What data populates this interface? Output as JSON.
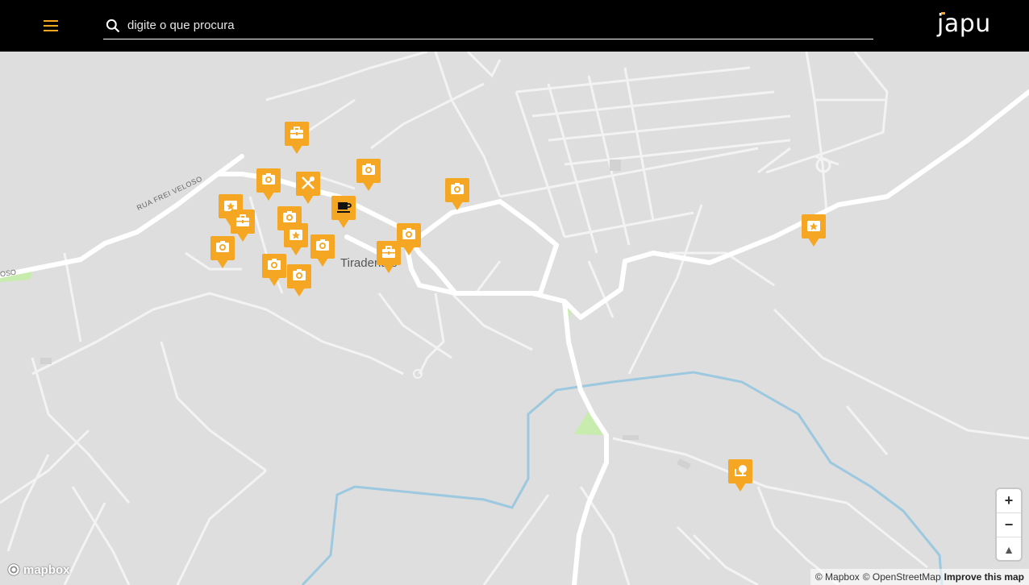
{
  "header": {
    "search_placeholder": "digite o que procura",
    "logo_text": "japu",
    "accent_color": "#f5a623"
  },
  "map": {
    "town_label": "Tiradentes",
    "road_label": "RUA FREI VELOSO",
    "road_label_cut": "OSO",
    "marker_color": "#f5a623",
    "markers": [
      {
        "type": "briefcase-icon"
      },
      {
        "type": "camera-icon"
      },
      {
        "type": "restaurant-icon"
      },
      {
        "type": "coffee-icon"
      },
      {
        "type": "camera-icon"
      },
      {
        "type": "camera-icon"
      },
      {
        "type": "ticket-icon"
      },
      {
        "type": "briefcase-icon"
      },
      {
        "type": "camera-icon"
      },
      {
        "type": "ticket-icon"
      },
      {
        "type": "camera-icon"
      },
      {
        "type": "camera-icon"
      },
      {
        "type": "camera-icon"
      },
      {
        "type": "camera-icon"
      },
      {
        "type": "camera-icon"
      },
      {
        "type": "briefcase-icon"
      },
      {
        "type": "ticket-icon"
      },
      {
        "type": "landmark-icon"
      }
    ]
  },
  "controls": {
    "zoom_in": "+",
    "zoom_out": "−",
    "compass": "▲"
  },
  "attribution": {
    "mapbox": "© Mapbox",
    "osm": "© OpenStreetMap",
    "improve": "Improve this map",
    "logo": "mapbox"
  }
}
